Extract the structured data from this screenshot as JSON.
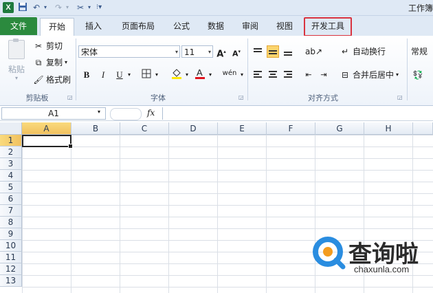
{
  "titlebar": {
    "app_icon": "X",
    "window_title": "工作簿",
    "save_icon": "save-icon",
    "undo_icon": "undo-icon",
    "redo_icon": "redo-icon"
  },
  "tabs": [
    {
      "label": "文件"
    },
    {
      "label": "开始"
    },
    {
      "label": "插入"
    },
    {
      "label": "页面布局"
    },
    {
      "label": "公式"
    },
    {
      "label": "数据"
    },
    {
      "label": "审阅"
    },
    {
      "label": "视图"
    },
    {
      "label": "开发工具"
    }
  ],
  "ribbon": {
    "clipboard": {
      "paste": "粘贴",
      "cut": "剪切",
      "copy": "复制",
      "format_painter": "格式刷",
      "group_label": "剪贴板"
    },
    "font": {
      "font_name": "宋体",
      "font_size": "11",
      "grow": "A",
      "shrink": "A",
      "bold": "B",
      "italic": "I",
      "underline": "U",
      "phonetic": "wén",
      "group_label": "字体"
    },
    "alignment": {
      "wrap_text": "自动换行",
      "merge_center": "合并后居中",
      "group_label": "对齐方式"
    },
    "number": {
      "format": "常规"
    }
  },
  "formula_bar": {
    "name_box": "A1",
    "fx": "fx",
    "content": ""
  },
  "sheet": {
    "columns": [
      "A",
      "B",
      "C",
      "D",
      "E",
      "F",
      "G",
      "H"
    ],
    "rows": [
      "1",
      "2",
      "3",
      "4",
      "5",
      "6",
      "7",
      "8",
      "9",
      "10",
      "11",
      "12",
      "13"
    ],
    "selected_column": "A",
    "selected_row": "1"
  },
  "watermark": {
    "text": "查询啦",
    "sub": "chaxunla.com"
  },
  "colors": {
    "file_tab": "#2b8a3e",
    "highlight_box": "#d9333f",
    "accent_yellow": "#fbd46d"
  }
}
